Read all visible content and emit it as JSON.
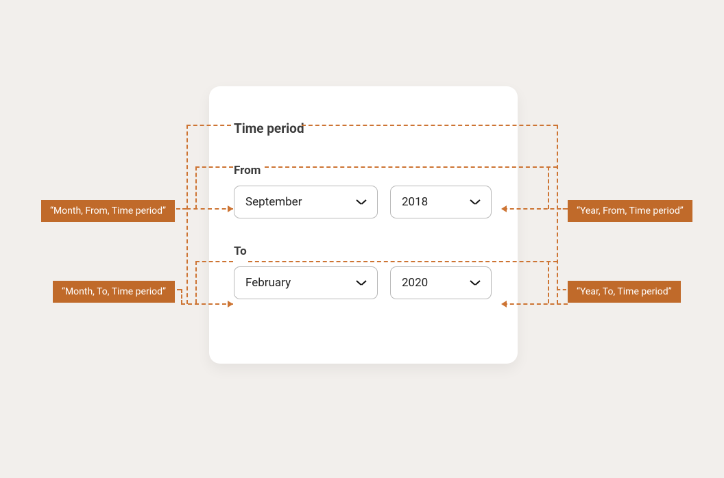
{
  "card": {
    "title": "Time period",
    "from": {
      "label": "From",
      "month": "September",
      "year": "2018"
    },
    "to": {
      "label": "To",
      "month": "February",
      "year": "2020"
    }
  },
  "annotations": {
    "month_from": "“Month, From, Time period”",
    "year_from": "“Year, From, Time period”",
    "month_to": "“Month, To, Time period”",
    "year_to": "“Year, To, Time period”"
  }
}
